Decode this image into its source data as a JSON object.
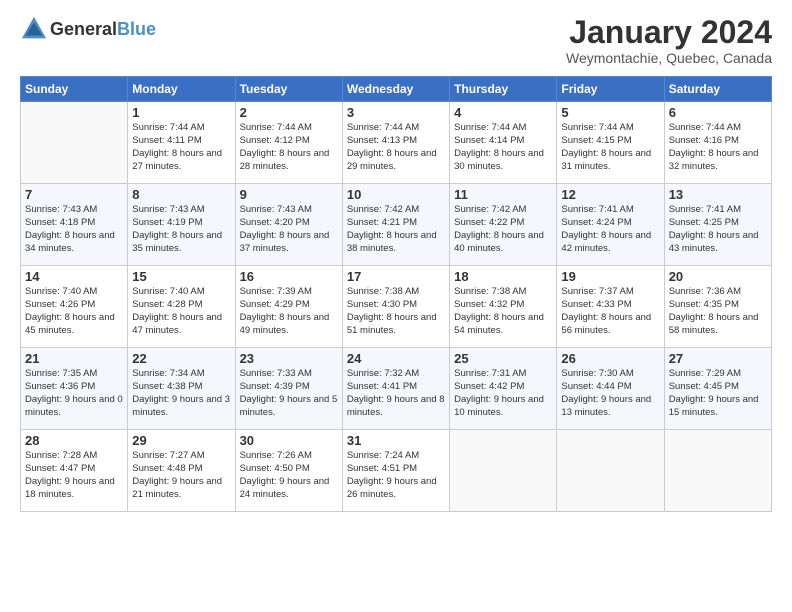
{
  "header": {
    "logo_general": "General",
    "logo_blue": "Blue",
    "month_year": "January 2024",
    "location": "Weymontachie, Quebec, Canada"
  },
  "weekdays": [
    "Sunday",
    "Monday",
    "Tuesday",
    "Wednesday",
    "Thursday",
    "Friday",
    "Saturday"
  ],
  "weeks": [
    [
      {
        "day": "",
        "sunrise": "",
        "sunset": "",
        "daylight": ""
      },
      {
        "day": "1",
        "sunrise": "Sunrise: 7:44 AM",
        "sunset": "Sunset: 4:11 PM",
        "daylight": "Daylight: 8 hours and 27 minutes."
      },
      {
        "day": "2",
        "sunrise": "Sunrise: 7:44 AM",
        "sunset": "Sunset: 4:12 PM",
        "daylight": "Daylight: 8 hours and 28 minutes."
      },
      {
        "day": "3",
        "sunrise": "Sunrise: 7:44 AM",
        "sunset": "Sunset: 4:13 PM",
        "daylight": "Daylight: 8 hours and 29 minutes."
      },
      {
        "day": "4",
        "sunrise": "Sunrise: 7:44 AM",
        "sunset": "Sunset: 4:14 PM",
        "daylight": "Daylight: 8 hours and 30 minutes."
      },
      {
        "day": "5",
        "sunrise": "Sunrise: 7:44 AM",
        "sunset": "Sunset: 4:15 PM",
        "daylight": "Daylight: 8 hours and 31 minutes."
      },
      {
        "day": "6",
        "sunrise": "Sunrise: 7:44 AM",
        "sunset": "Sunset: 4:16 PM",
        "daylight": "Daylight: 8 hours and 32 minutes."
      }
    ],
    [
      {
        "day": "7",
        "sunrise": "Sunrise: 7:43 AM",
        "sunset": "Sunset: 4:18 PM",
        "daylight": "Daylight: 8 hours and 34 minutes."
      },
      {
        "day": "8",
        "sunrise": "Sunrise: 7:43 AM",
        "sunset": "Sunset: 4:19 PM",
        "daylight": "Daylight: 8 hours and 35 minutes."
      },
      {
        "day": "9",
        "sunrise": "Sunrise: 7:43 AM",
        "sunset": "Sunset: 4:20 PM",
        "daylight": "Daylight: 8 hours and 37 minutes."
      },
      {
        "day": "10",
        "sunrise": "Sunrise: 7:42 AM",
        "sunset": "Sunset: 4:21 PM",
        "daylight": "Daylight: 8 hours and 38 minutes."
      },
      {
        "day": "11",
        "sunrise": "Sunrise: 7:42 AM",
        "sunset": "Sunset: 4:22 PM",
        "daylight": "Daylight: 8 hours and 40 minutes."
      },
      {
        "day": "12",
        "sunrise": "Sunrise: 7:41 AM",
        "sunset": "Sunset: 4:24 PM",
        "daylight": "Daylight: 8 hours and 42 minutes."
      },
      {
        "day": "13",
        "sunrise": "Sunrise: 7:41 AM",
        "sunset": "Sunset: 4:25 PM",
        "daylight": "Daylight: 8 hours and 43 minutes."
      }
    ],
    [
      {
        "day": "14",
        "sunrise": "Sunrise: 7:40 AM",
        "sunset": "Sunset: 4:26 PM",
        "daylight": "Daylight: 8 hours and 45 minutes."
      },
      {
        "day": "15",
        "sunrise": "Sunrise: 7:40 AM",
        "sunset": "Sunset: 4:28 PM",
        "daylight": "Daylight: 8 hours and 47 minutes."
      },
      {
        "day": "16",
        "sunrise": "Sunrise: 7:39 AM",
        "sunset": "Sunset: 4:29 PM",
        "daylight": "Daylight: 8 hours and 49 minutes."
      },
      {
        "day": "17",
        "sunrise": "Sunrise: 7:38 AM",
        "sunset": "Sunset: 4:30 PM",
        "daylight": "Daylight: 8 hours and 51 minutes."
      },
      {
        "day": "18",
        "sunrise": "Sunrise: 7:38 AM",
        "sunset": "Sunset: 4:32 PM",
        "daylight": "Daylight: 8 hours and 54 minutes."
      },
      {
        "day": "19",
        "sunrise": "Sunrise: 7:37 AM",
        "sunset": "Sunset: 4:33 PM",
        "daylight": "Daylight: 8 hours and 56 minutes."
      },
      {
        "day": "20",
        "sunrise": "Sunrise: 7:36 AM",
        "sunset": "Sunset: 4:35 PM",
        "daylight": "Daylight: 8 hours and 58 minutes."
      }
    ],
    [
      {
        "day": "21",
        "sunrise": "Sunrise: 7:35 AM",
        "sunset": "Sunset: 4:36 PM",
        "daylight": "Daylight: 9 hours and 0 minutes."
      },
      {
        "day": "22",
        "sunrise": "Sunrise: 7:34 AM",
        "sunset": "Sunset: 4:38 PM",
        "daylight": "Daylight: 9 hours and 3 minutes."
      },
      {
        "day": "23",
        "sunrise": "Sunrise: 7:33 AM",
        "sunset": "Sunset: 4:39 PM",
        "daylight": "Daylight: 9 hours and 5 minutes."
      },
      {
        "day": "24",
        "sunrise": "Sunrise: 7:32 AM",
        "sunset": "Sunset: 4:41 PM",
        "daylight": "Daylight: 9 hours and 8 minutes."
      },
      {
        "day": "25",
        "sunrise": "Sunrise: 7:31 AM",
        "sunset": "Sunset: 4:42 PM",
        "daylight": "Daylight: 9 hours and 10 minutes."
      },
      {
        "day": "26",
        "sunrise": "Sunrise: 7:30 AM",
        "sunset": "Sunset: 4:44 PM",
        "daylight": "Daylight: 9 hours and 13 minutes."
      },
      {
        "day": "27",
        "sunrise": "Sunrise: 7:29 AM",
        "sunset": "Sunset: 4:45 PM",
        "daylight": "Daylight: 9 hours and 15 minutes."
      }
    ],
    [
      {
        "day": "28",
        "sunrise": "Sunrise: 7:28 AM",
        "sunset": "Sunset: 4:47 PM",
        "daylight": "Daylight: 9 hours and 18 minutes."
      },
      {
        "day": "29",
        "sunrise": "Sunrise: 7:27 AM",
        "sunset": "Sunset: 4:48 PM",
        "daylight": "Daylight: 9 hours and 21 minutes."
      },
      {
        "day": "30",
        "sunrise": "Sunrise: 7:26 AM",
        "sunset": "Sunset: 4:50 PM",
        "daylight": "Daylight: 9 hours and 24 minutes."
      },
      {
        "day": "31",
        "sunrise": "Sunrise: 7:24 AM",
        "sunset": "Sunset: 4:51 PM",
        "daylight": "Daylight: 9 hours and 26 minutes."
      },
      {
        "day": "",
        "sunrise": "",
        "sunset": "",
        "daylight": ""
      },
      {
        "day": "",
        "sunrise": "",
        "sunset": "",
        "daylight": ""
      },
      {
        "day": "",
        "sunrise": "",
        "sunset": "",
        "daylight": ""
      }
    ]
  ]
}
